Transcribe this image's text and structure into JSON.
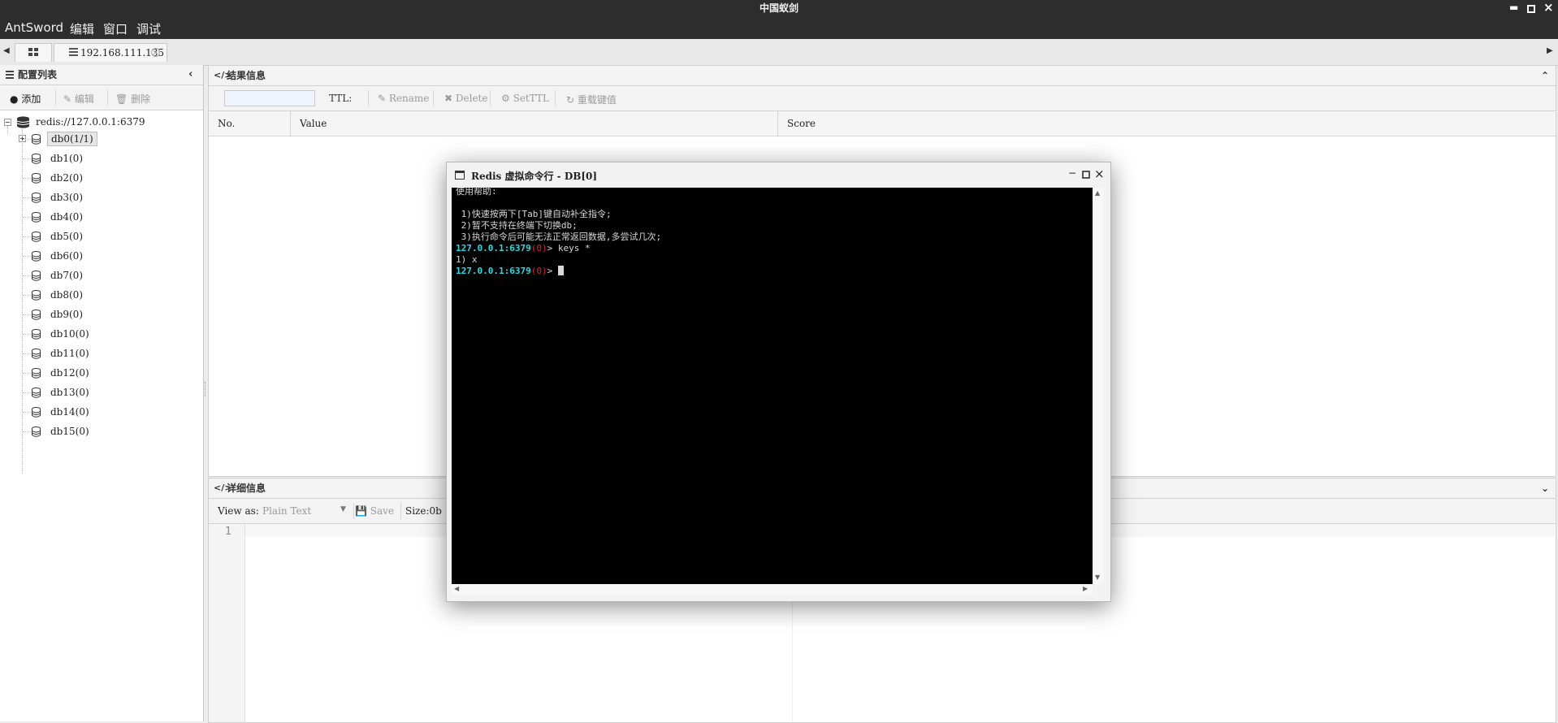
{
  "window": {
    "title": "中国蚁剑"
  },
  "menu": {
    "items": [
      "AntSword",
      "编辑",
      "窗口",
      "调试"
    ]
  },
  "tabs": {
    "home_icon": "grid-icon",
    "active_tab": "192.168.111.135"
  },
  "sidebar": {
    "title": "配置列表",
    "buttons": {
      "add": "添加",
      "edit": "编辑",
      "delete": "删除"
    },
    "root": "redis://127.0.0.1:6379",
    "dbs": [
      "db0(1/1)",
      "db1(0)",
      "db2(0)",
      "db3(0)",
      "db4(0)",
      "db5(0)",
      "db6(0)",
      "db7(0)",
      "db8(0)",
      "db9(0)",
      "db10(0)",
      "db11(0)",
      "db12(0)",
      "db13(0)",
      "db14(0)",
      "db15(0)"
    ]
  },
  "result": {
    "title": "结果信息",
    "search_value": "",
    "ttl_label": "TTL:",
    "buttons": {
      "rename": "Rename",
      "delete": "Delete",
      "setttl": "SetTTL",
      "reload": "重载键值"
    },
    "columns": [
      "No.",
      "Value",
      "Score"
    ]
  },
  "detail": {
    "title": "详细信息",
    "view_as_label": "View as:",
    "view_as_value": "Plain Text",
    "save_label": "Save",
    "size_label": "Size:0b",
    "line_number": "1"
  },
  "terminal": {
    "title": "Redis 虚拟命令行 - DB[0]",
    "help_title": "使用帮助:",
    "help_lines": [
      " 1)快速按两下[Tab]键自动补全指令;",
      " 2)暂不支持在终端下切换db;",
      " 3)执行命令后可能无法正常返回数据,多尝试几次;"
    ],
    "prompt_host": "127.0.0.1:6379",
    "prompt_db": "(0)",
    "prompt_suffix": "> ",
    "command": "keys *",
    "output": "1) x"
  }
}
